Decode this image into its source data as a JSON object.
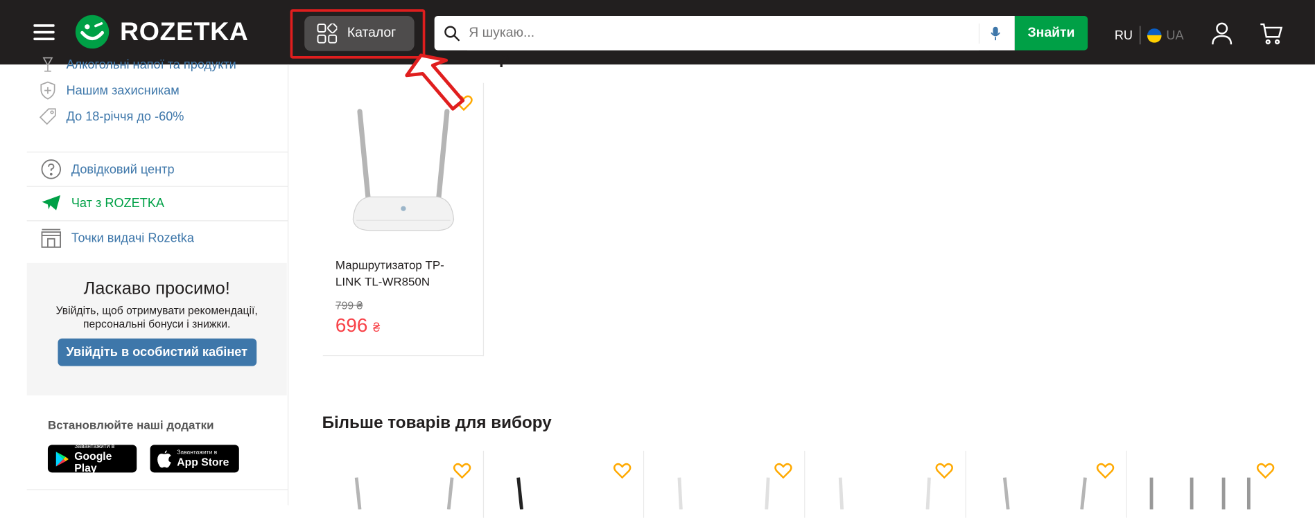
{
  "header": {
    "logo_text": "ROZETKA",
    "catalog_label": "Каталог",
    "search_placeholder": "Я шукаю...",
    "find_button": "Знайти",
    "lang_ru": "RU",
    "lang_ua": "UA",
    "highlight_color": "#e01e1e"
  },
  "sidebar": {
    "links": [
      {
        "label": "Алкогольні напої та продукти",
        "icon": "glass-icon"
      },
      {
        "label": "Нашим захисникам",
        "icon": "shield-icon"
      },
      {
        "label": "До 18-річчя до -60%",
        "icon": "tag-icon"
      }
    ],
    "service_links": [
      {
        "label": "Довідковий центр",
        "icon": "help-icon"
      },
      {
        "label": "Чат з ROZETKA",
        "icon": "telegram-icon"
      },
      {
        "label": "Точки видачі Rozetka",
        "icon": "pickup-point-icon"
      }
    ],
    "welcome": {
      "title": "Ласкаво просимо!",
      "text": "Увійдіть, щоб отримувати рекомендації, персональні бонуси і знижки.",
      "button": "Увійдіть в особистий кабінет"
    },
    "apps": {
      "title": "Встановлюйте наші додатки",
      "google_small": "Завантажити в",
      "google_big": "Google Play",
      "apple_small": "Завантажити в",
      "apple_big": "App Store"
    }
  },
  "main": {
    "section_top_title": "р",
    "product": {
      "title": "Маршрутизатор TP-LINK TL-WR850N",
      "old_price": "799 ₴",
      "price": "696",
      "currency": "₴"
    },
    "more_title": "Більше товарів для вибору"
  },
  "colors": {
    "header_bg": "#221f1f",
    "brand_green": "#00a046",
    "link_blue": "#3e77aa",
    "price_red": "#f84147",
    "heart_orange": "#ffa900"
  }
}
